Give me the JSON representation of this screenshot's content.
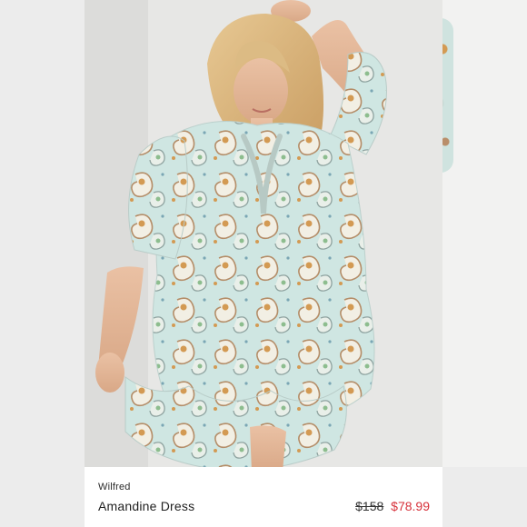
{
  "listing": {
    "brand": "Wilfred",
    "title": "Amandine Dress",
    "original_price": "$158",
    "sale_price": "$78.99"
  },
  "colors": {
    "sale": "#d7323b",
    "dress_base": "#cfe6e2",
    "paisley_orange": "#d39a53",
    "hair": "#d8b27a"
  },
  "images": {
    "main": "model-wearing-paisley-dress-photo",
    "next": "next-photo-preview"
  }
}
